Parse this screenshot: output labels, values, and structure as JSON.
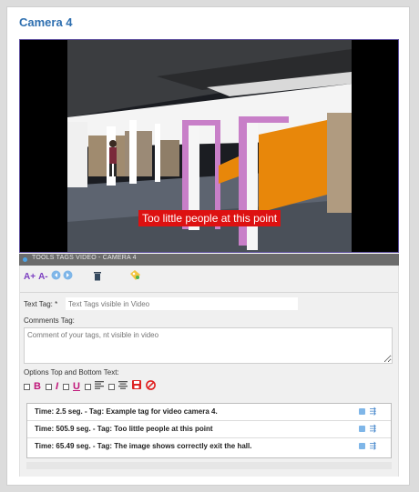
{
  "header": {
    "title": "Camera 4"
  },
  "video": {
    "subtitle": "Too little people at this point"
  },
  "toolbar": {
    "label": "TOOLS TAGS VIDEO - CAMERA 4",
    "font_increase": "A+",
    "font_decrease": "A-"
  },
  "form": {
    "text_tag_label": "Text Tag: *",
    "text_tag_placeholder": "Text Tags visible in Video",
    "comments_label": "Comments Tag:",
    "comments_placeholder": "Comment of your tags, nt visible in video",
    "options_label": "Options Top and Bottom Text:"
  },
  "format": {
    "bold": "B",
    "italic": "I",
    "underline": "U"
  },
  "tags": [
    {
      "text": "Time: 2.5 seg. - Tag: Example tag for video camera 4."
    },
    {
      "text": "Time: 505.9 seg. - Tag: Too little people at this point"
    },
    {
      "text": "Time: 65.49 seg. - Tag: The image shows correctly exit the hall."
    }
  ],
  "colors": {
    "accent": "#2e6fb0",
    "subtitle_bg": "#dd1111",
    "orange_wall": "#e8870a"
  }
}
